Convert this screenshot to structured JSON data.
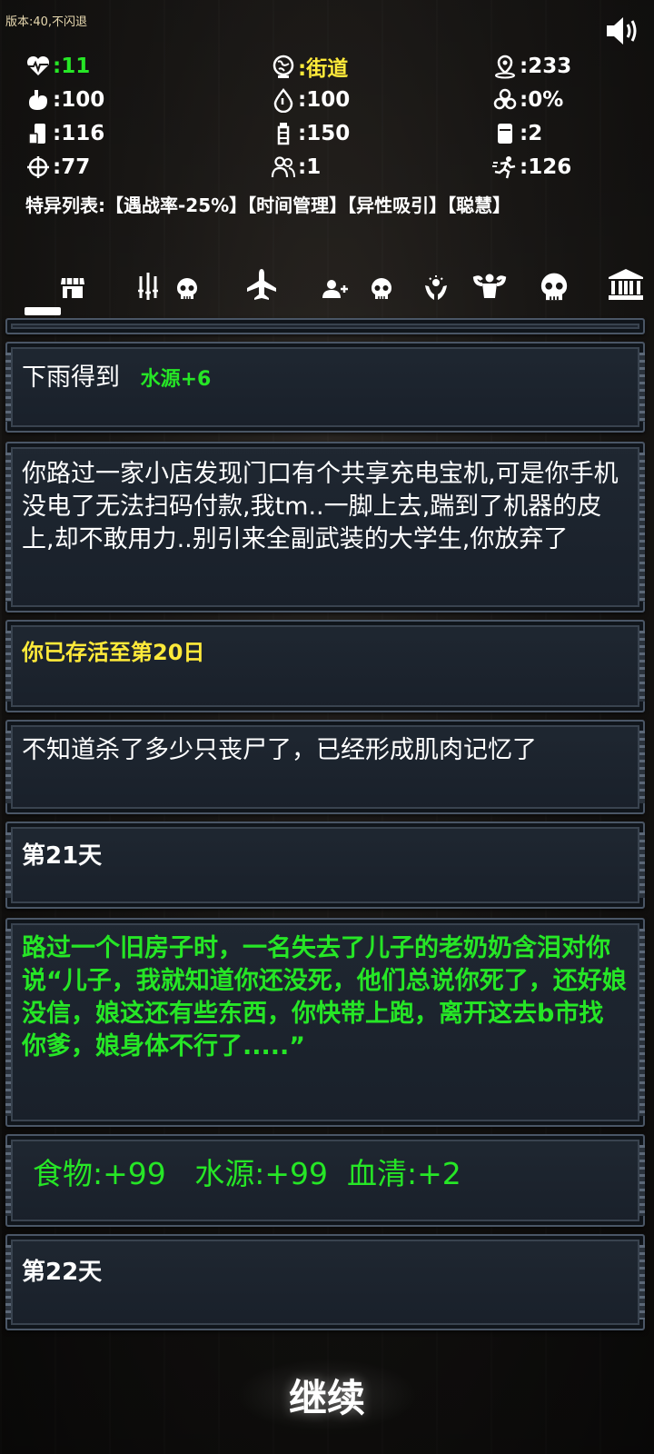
{
  "version_text": "版本:40,不闪退",
  "colors": {
    "green": "#26e626",
    "yellow": "#ffea3a",
    "white": "#ffffff"
  },
  "stats": [
    {
      "icon": "heartbeat-icon",
      "value": ":11",
      "color": "green"
    },
    {
      "icon": "location-globe-icon",
      "value": ":街道",
      "color": "yellow"
    },
    {
      "icon": "distance-marker-icon",
      "value": ":233",
      "color": "white"
    },
    {
      "icon": "stomach-icon",
      "value": ":100",
      "color": "white"
    },
    {
      "icon": "water-drop-icon",
      "value": ":100",
      "color": "white"
    },
    {
      "icon": "biohazard-icon",
      "value": ":0%",
      "color": "white"
    },
    {
      "icon": "food-can-icon",
      "value": ":116",
      "color": "white"
    },
    {
      "icon": "water-bottle-icon",
      "value": ":150",
      "color": "white"
    },
    {
      "icon": "serum-vial-icon",
      "value": ":2",
      "color": "white"
    },
    {
      "icon": "crosshair-icon",
      "value": ":77",
      "color": "white"
    },
    {
      "icon": "survivors-icon",
      "value": ":1",
      "color": "white"
    },
    {
      "icon": "running-man-icon",
      "value": ":126",
      "color": "white"
    }
  ],
  "traits": "特异列表:【遇战率-25%】【时间管理】【异性吸引】【聪慧】",
  "tabs": [
    "shop-icon",
    "weapons-icon",
    "skull-icon",
    "airplane-icon",
    "add-person-icon",
    "skull-icon",
    "hands-icon",
    "muscle-icon",
    "skull-large-icon",
    "bank-icon"
  ],
  "log": [
    {
      "text": "下雨得到",
      "extra": "水源+6"
    },
    {
      "text": "你路过一家小店发现门口有个共享充电宝机,可是你手机没电了无法扫码付款,我tm..一脚上去,踹到了机器的皮上,却不敢用力..别引来全副武装的大学生,你放弃了"
    },
    {
      "text": "你已存活至第20日"
    },
    {
      "text": "不知道杀了多少只丧尸了，已经形成肌肉记忆了"
    },
    {
      "text": "第21天"
    },
    {
      "text": "路过一个旧房子时，一名失去了儿子的老奶奶含泪对你说“儿子，我就知道你还没死，他们总说你死了，还好娘没信，娘这还有些东西，你快带上跑，离开这去b市找你爹，娘身体不行了.....”"
    },
    {
      "text": "食物:+99   水源:+99  血清:+2"
    },
    {
      "text": "第22天"
    }
  ],
  "continue_label": "继续"
}
